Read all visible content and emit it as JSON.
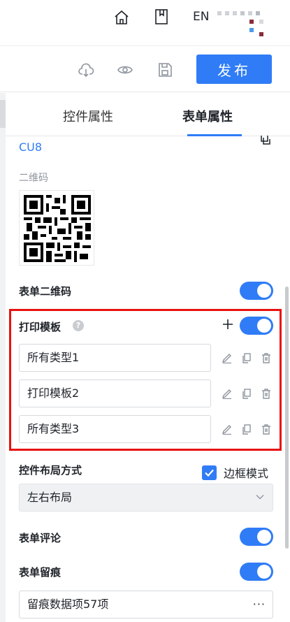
{
  "topbar": {
    "lang_label": "EN",
    "icons": [
      "home-icon",
      "book-icon",
      "brand-logo"
    ]
  },
  "toolbar": {
    "publish_label": "发布",
    "icons": [
      "cloud-download-icon",
      "eye-icon",
      "save-icon"
    ]
  },
  "tabs": [
    {
      "label": "控件属性",
      "active": false
    },
    {
      "label": "表单属性",
      "active": true
    }
  ],
  "form": {
    "code": "CU8",
    "qr_label": "二维码",
    "qr_toggle": {
      "label": "表单二维码",
      "on": true
    },
    "print": {
      "label": "打印模板",
      "help_glyph": "?",
      "on": true,
      "templates": [
        "所有类型1",
        "打印模板2",
        "所有类型3"
      ]
    },
    "layout": {
      "label": "控件布局方式",
      "border_mode_label": "边框模式",
      "border_mode_checked": true,
      "selected": "左右布局"
    },
    "comment": {
      "label": "表单评论",
      "on": true
    },
    "trace": {
      "label": "表单留痕",
      "on": true,
      "value": "留痕数据项57项",
      "more": "···"
    }
  },
  "colors": {
    "accent": "#2f7cf6",
    "highlight_border": "#e8110f",
    "text": "#1f2329",
    "muted": "#8f959e"
  }
}
